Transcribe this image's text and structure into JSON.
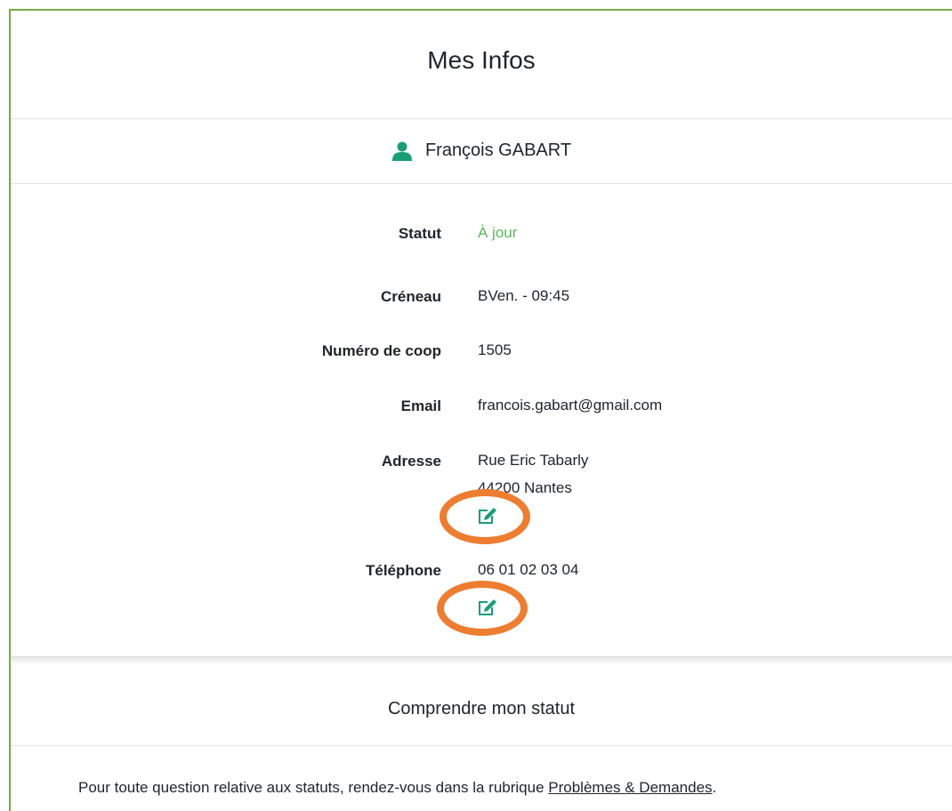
{
  "header": {
    "title": "Mes Infos"
  },
  "user": {
    "name": "François GABART",
    "icon": "user-icon"
  },
  "info": {
    "statut": {
      "label": "Statut",
      "value": "À jour"
    },
    "creneau": {
      "label": "Créneau",
      "value": "BVen. - 09:45"
    },
    "coop": {
      "label": "Numéro de coop",
      "value": "1505"
    },
    "email": {
      "label": "Email",
      "value": "francois.gabart@gmail.com"
    },
    "adresse": {
      "label": "Adresse",
      "line1": "Rue Eric Tabarly",
      "line2": "44200 Nantes"
    },
    "telephone": {
      "label": "Téléphone",
      "value": "06 01 02 03 04"
    }
  },
  "section": {
    "title": "Comprendre mon statut"
  },
  "footer": {
    "text": "Pour toute question relative aux statuts, rendez-vous dans la rubrique ",
    "link": "Problèmes & Demandes",
    "end": "."
  },
  "colors": {
    "accent": "#1a9e74",
    "status_ok": "#5cb85c",
    "highlight": "#ed7d31",
    "frame": "#70ad47"
  }
}
